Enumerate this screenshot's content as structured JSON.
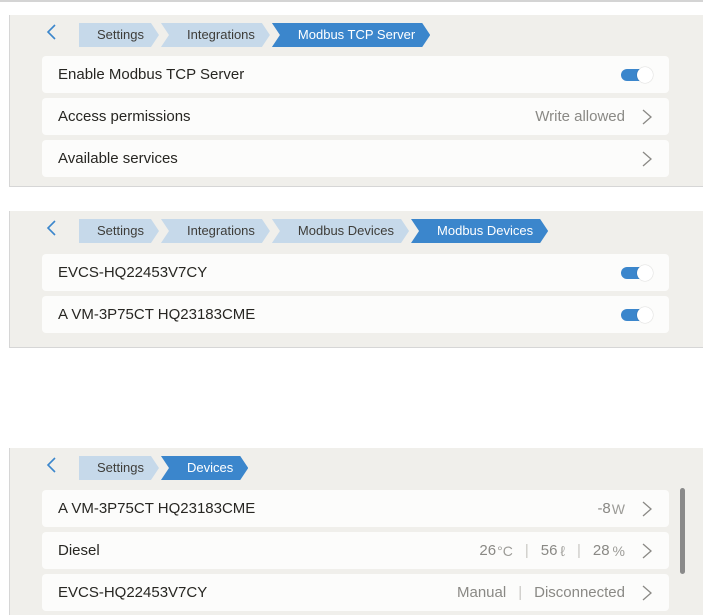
{
  "panel1": {
    "breadcrumbs": [
      "Settings",
      "Integrations",
      "Modbus TCP Server"
    ],
    "rows": [
      {
        "label": "Enable Modbus TCP Server",
        "toggle": true
      },
      {
        "label": "Access permissions",
        "value": "Write allowed"
      },
      {
        "label": "Available services"
      }
    ]
  },
  "panel2": {
    "breadcrumbs": [
      "Settings",
      "Integrations",
      "Modbus Devices",
      "Modbus Devices"
    ],
    "rows": [
      {
        "label": "EVCS-HQ22453V7CY",
        "toggle": true
      },
      {
        "label": "A VM-3P75CT HQ23183CME",
        "toggle": true
      }
    ]
  },
  "panel3": {
    "breadcrumbs": [
      "Settings",
      "Devices"
    ],
    "rows": [
      {
        "label": "A VM-3P75CT HQ23183CME",
        "power": "-8",
        "power_unit": "W"
      },
      {
        "label": "Diesel",
        "temp": "26",
        "temp_unit": "°C",
        "volume": "56",
        "volume_unit": "ℓ",
        "level": "28",
        "level_unit": "%"
      },
      {
        "label": "EVCS-HQ22453V7CY",
        "mode": "Manual",
        "status": "Disconnected"
      }
    ]
  },
  "colors": {
    "accent": "#3b86cc",
    "crumb": "#c6d9ea",
    "panel": "#f0efeb",
    "row": "#fcfcfb"
  },
  "icons": {
    "back": "chevron-left-icon",
    "chevron": "chevron-right-icon"
  }
}
